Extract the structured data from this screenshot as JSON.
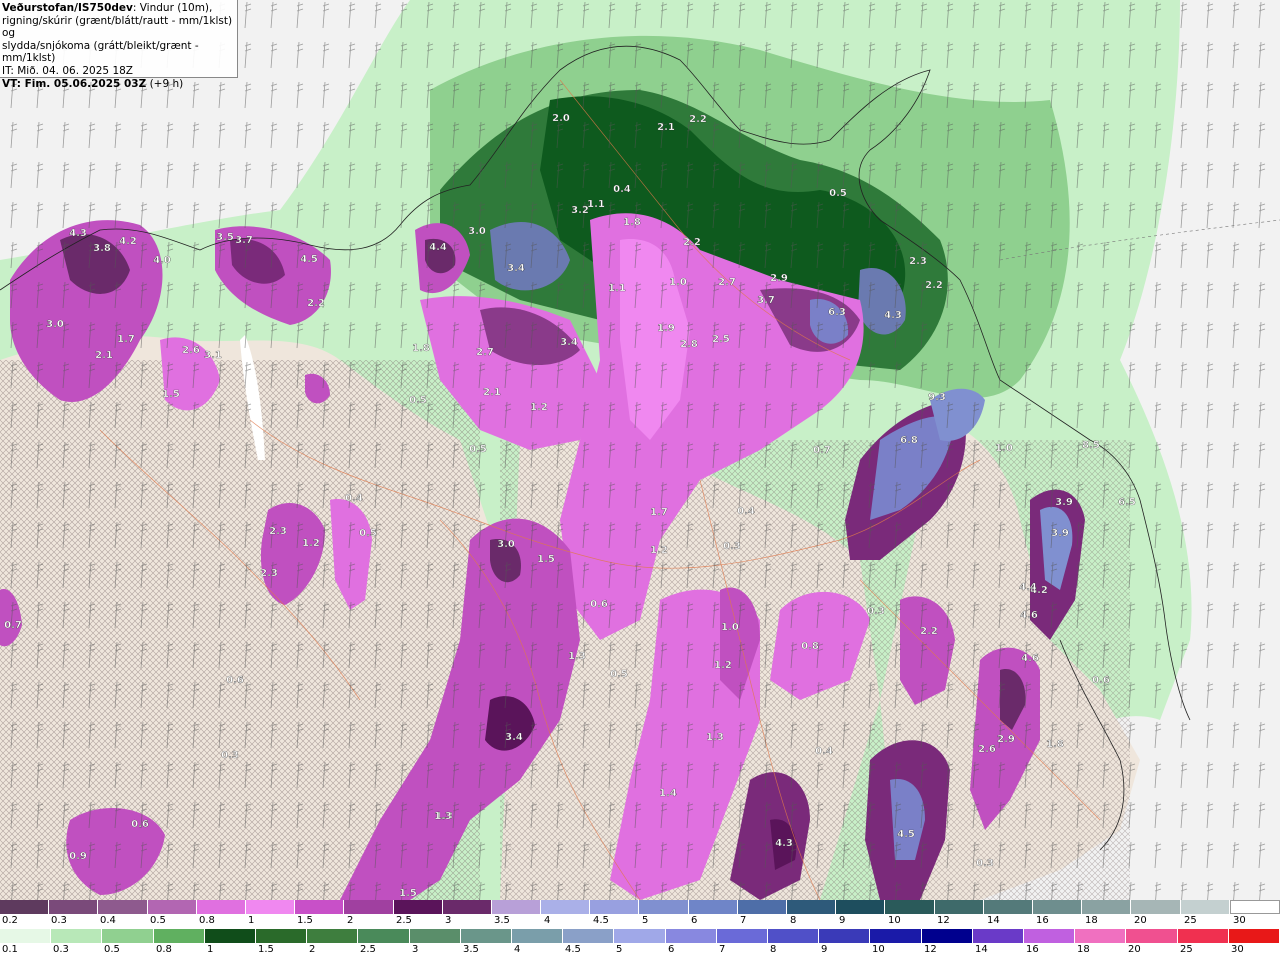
{
  "header": {
    "source": "Veðurstofan/IS750dev",
    "desc_line1": ": Vindur (10m),",
    "desc_line2": "rigning/skúrir (grænt/blátt/rautt - mm/1klst) og",
    "desc_line3": "slydda/snjókoma (grátt/bleikt/grænt - mm/1klst)",
    "it_line": "IT: Mið. 04. 06. 2025 18Z",
    "vt_line": "VT: Fim. 05.06.2025 03Z",
    "vt_offset": "(+9 h)"
  },
  "colors": {
    "sea": "#f2f2f2",
    "land": "#efe6dc",
    "rain_light": "#c8f0c8",
    "rain_mid": "#5aa05a",
    "rain_heavy": "#0e5a1e",
    "snow_light": "#ee88ee",
    "snow_mid": "#c050c0",
    "snow_heavy": "#6a2a6a",
    "intense": "#7a80c8"
  },
  "map_labels": [
    {
      "t": "2.0"
    },
    {
      "t": "2.1"
    },
    {
      "t": "2.2"
    },
    {
      "t": "0.4"
    },
    {
      "t": "1.1"
    },
    {
      "t": "0.5"
    },
    {
      "t": "3.2"
    },
    {
      "t": "1.8"
    },
    {
      "t": "2.2"
    },
    {
      "t": "3.0"
    },
    {
      "t": "3.4"
    },
    {
      "t": "4.4"
    },
    {
      "t": "4.3"
    },
    {
      "t": "3.8"
    },
    {
      "t": "4.2"
    },
    {
      "t": "4.0"
    },
    {
      "t": "3.5"
    },
    {
      "t": "3.7"
    },
    {
      "t": "4.5"
    },
    {
      "t": "2.2"
    },
    {
      "t": "3.0"
    },
    {
      "t": "1.7"
    },
    {
      "t": "2.1"
    },
    {
      "t": "2.6"
    },
    {
      "t": "3.1"
    },
    {
      "t": "1.5"
    },
    {
      "t": "1.8"
    },
    {
      "t": "2.7"
    },
    {
      "t": "3.4"
    },
    {
      "t": "1.9"
    },
    {
      "t": "2.8"
    },
    {
      "t": "2.5"
    },
    {
      "t": "2.7"
    },
    {
      "t": "3.7"
    },
    {
      "t": "6.3"
    },
    {
      "t": "4.3"
    },
    {
      "t": "2.3"
    },
    {
      "t": "2.2"
    },
    {
      "t": "2.9"
    },
    {
      "t": "1.0"
    },
    {
      "t": "1.1"
    },
    {
      "t": "2.1"
    },
    {
      "t": "1.2"
    },
    {
      "t": "1.7"
    },
    {
      "t": "1.2"
    },
    {
      "t": "0.4"
    },
    {
      "t": "0.3"
    },
    {
      "t": "3.0"
    },
    {
      "t": "1.5"
    },
    {
      "t": "0.6"
    },
    {
      "t": "1.3"
    },
    {
      "t": "0.5"
    },
    {
      "t": "1.0"
    },
    {
      "t": "1.2"
    },
    {
      "t": "1.3"
    },
    {
      "t": "1.4"
    },
    {
      "t": "3.4"
    },
    {
      "t": "1.3"
    },
    {
      "t": "0.8"
    },
    {
      "t": "0.4"
    },
    {
      "t": "2.2"
    },
    {
      "t": "9.3"
    },
    {
      "t": "6.8"
    },
    {
      "t": "1.0"
    },
    {
      "t": "8.5"
    },
    {
      "t": "6.5"
    },
    {
      "t": "3.9"
    },
    {
      "t": "3.9"
    },
    {
      "t": "4.2"
    },
    {
      "t": "4.6"
    },
    {
      "t": "4.6"
    },
    {
      "t": "2.9"
    },
    {
      "t": "2.6"
    },
    {
      "t": "4.3"
    },
    {
      "t": "4.5"
    },
    {
      "t": "2.3"
    },
    {
      "t": "1.2"
    },
    {
      "t": "2.3"
    },
    {
      "t": "0.5"
    },
    {
      "t": "0.4"
    },
    {
      "t": "0.7"
    },
    {
      "t": "0.6"
    },
    {
      "t": "0.6"
    },
    {
      "t": "0.3"
    },
    {
      "t": "0.9"
    },
    {
      "t": "0.5"
    },
    {
      "t": "0.5"
    },
    {
      "t": "0.7"
    },
    {
      "t": "0.3"
    },
    {
      "t": "1.5"
    },
    {
      "t": "1.3"
    },
    {
      "t": "0.3"
    },
    {
      "t": "1.8"
    },
    {
      "t": "0.6"
    },
    {
      "t": "4.4"
    }
  ],
  "legend_top": {
    "labels": [
      "0.2",
      "0.3",
      "0.4",
      "0.5",
      "0.8",
      "1",
      "1.5",
      "2",
      "2.5",
      "3",
      "3.5",
      "4",
      "4.5",
      "5",
      "6",
      "7",
      "8",
      "9",
      "10",
      "12",
      "14",
      "16",
      "18",
      "20",
      "25",
      "30"
    ],
    "colors": [
      "#5e3a5e",
      "#7a4a7a",
      "#8e5a8e",
      "#b266b2",
      "#e070e0",
      "#f088f0",
      "#c850c8",
      "#a040a0",
      "#5a145a",
      "#6a2a6a",
      "#b8a0d8",
      "#aab0e8",
      "#98a0e0",
      "#8090d0",
      "#6f85c8",
      "#4e6ea8",
      "#2e5a7a",
      "#1e4e5e",
      "#2a5a5a",
      "#3e6a6a",
      "#547a7a",
      "#6e8e8e",
      "#8aa2a2",
      "#a6b6b6",
      "#c4d0d0",
      "#ffffff"
    ]
  },
  "legend_bottom": {
    "labels": [
      "0.1",
      "0.3",
      "0.5",
      "0.8",
      "1",
      "1.5",
      "2",
      "2.5",
      "3",
      "3.5",
      "4",
      "4.5",
      "5",
      "6",
      "7",
      "8",
      "9",
      "10",
      "12",
      "14",
      "16",
      "18",
      "20",
      "25",
      "30"
    ],
    "colors": [
      "#e6f8e6",
      "#b8e8b8",
      "#90d090",
      "#60b060",
      "#104d1a",
      "#2a6a2a",
      "#3e7e3e",
      "#4a8a5a",
      "#5a8e6a",
      "#6a968a",
      "#7a9eaa",
      "#8aa0c8",
      "#a0a8e8",
      "#8888e0",
      "#6a6ad8",
      "#5050c8",
      "#3a3ab8",
      "#1a1aa8",
      "#00008e",
      "#6a3ac8",
      "#c060e0",
      "#f070c0",
      "#f05090",
      "#f03050",
      "#e81818"
    ]
  }
}
